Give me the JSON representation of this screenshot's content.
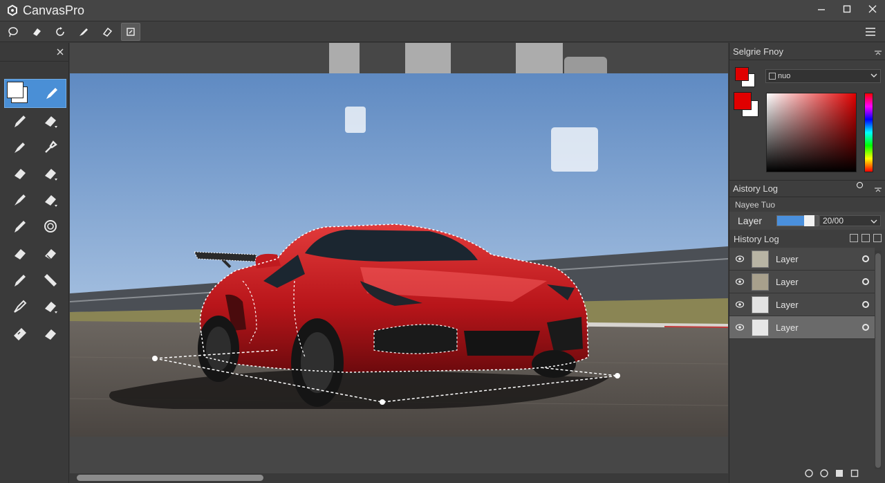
{
  "app": {
    "title": "CanvasPro",
    "logo_icon": "hexagon-logo-icon"
  },
  "window_controls": [
    "minimize-icon",
    "maximize-icon",
    "close-icon"
  ],
  "toolbar": {
    "tools": [
      "lasso-icon",
      "eraser-icon",
      "rotate-icon",
      "brush-icon",
      "eraser-alt-icon",
      "crop-icon"
    ],
    "active_index": 5,
    "menu_icon": "hamburger-menu-icon"
  },
  "tool_panel": {
    "close_icon": "close-icon",
    "active_tool": "pen-icon",
    "tools": [
      "pencil-icon",
      "eraser-icon",
      "marker-icon",
      "pipette-icon",
      "eraser-icon",
      "eraser-icon",
      "brush-icon",
      "eraser-icon",
      "pencil-icon",
      "stamp-icon",
      "eraser-icon",
      "eraser-icon",
      "pencil-icon",
      "ruler-icon",
      "brush-icon",
      "eraser-icon",
      "bandage-icon",
      "eraser-icon"
    ]
  },
  "canvas": {
    "image_subject": "red sports car on race track with selection marquee"
  },
  "right_panel": {
    "color_header": "Selgrie Fnoy",
    "mode_select": "nuo",
    "colors": {
      "foreground": "#e00000",
      "background": "#ffffff"
    },
    "history_header": "Aistory Log",
    "sub_label": "Nayee Tuo",
    "layer_control": {
      "label": "Layer",
      "opacity": 0.8,
      "value": "20/00"
    },
    "history_log_label": "History Log",
    "layers": [
      {
        "name": "Layer",
        "thumb": "#b8b4a4",
        "selected": false
      },
      {
        "name": "Layer",
        "thumb": "#a8a08c",
        "selected": false
      },
      {
        "name": "Layer",
        "thumb": "#e2e2e2",
        "selected": false
      },
      {
        "name": "Layer",
        "thumb": "#e6e6e6",
        "selected": true
      }
    ],
    "bottom_icons": [
      "circle-icon",
      "circle-icon",
      "square-fill-icon",
      "square-icon"
    ]
  }
}
